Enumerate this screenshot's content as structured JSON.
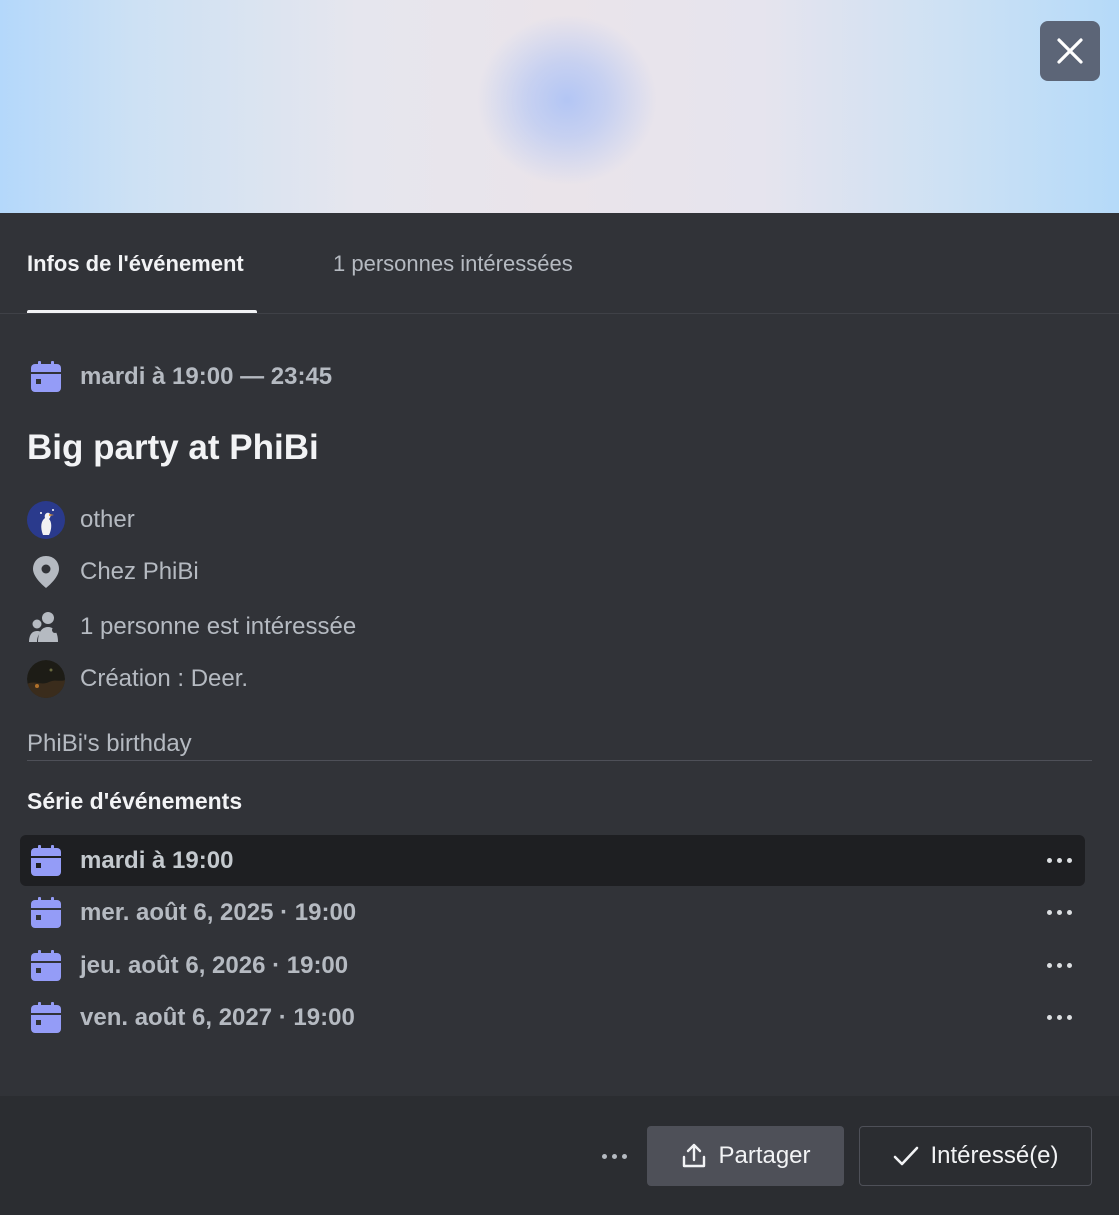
{
  "tabs": {
    "info_label": "Infos de l'événement",
    "interested_label": "1 personnes intéressées"
  },
  "event": {
    "when": "mardi à 19:00 — 23:45",
    "title": "Big party at PhiBi",
    "server": "other",
    "location": "Chez PhiBi",
    "interested": "1 personne est intéressée",
    "creator": "Création : Deer.",
    "description": "PhiBi's birthday"
  },
  "series": {
    "heading": "Série d'événements",
    "items": [
      {
        "label": "mardi à 19:00"
      },
      {
        "label": "mer. août 6, 2025 · 19:00"
      },
      {
        "label": "jeu. août 6, 2026 · 19:00"
      },
      {
        "label": "ven. août 6, 2027 · 19:00"
      }
    ]
  },
  "footer": {
    "share_label": "Partager",
    "interested_label": "Intéressé(e)"
  },
  "icons": {
    "calendar": "calendar-icon",
    "pin": "location-pin-icon",
    "people": "people-icon",
    "share": "share-icon",
    "check": "check-icon",
    "close": "close-icon"
  },
  "colors": {
    "accent_calendar": "#949cf7",
    "background": "#313338",
    "footer": "#2b2d31"
  }
}
